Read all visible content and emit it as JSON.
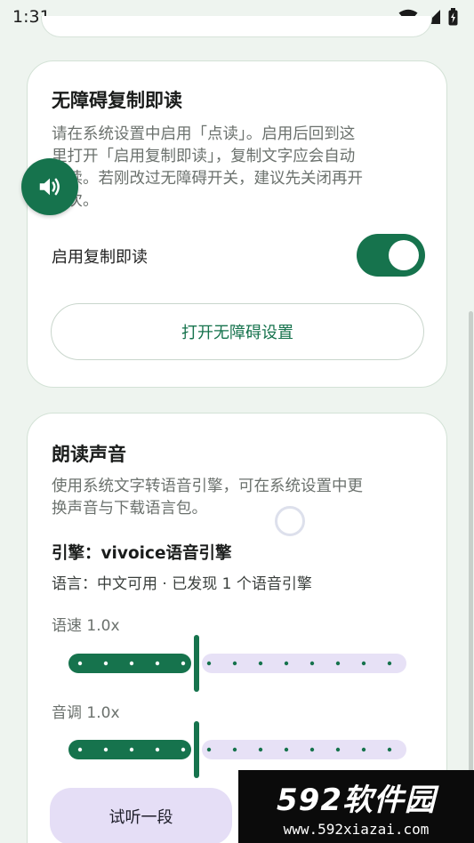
{
  "status_bar": {
    "time": "1:31"
  },
  "a11y_card": {
    "title": "无障碍复制即读",
    "desc_lines": [
      "请在系统设置中启用「点读」。启用后回到这",
      "里打开「启用复制即读」，复制文字应会自动",
      "朗读。若刚改过无障碍开关，建议先关闭再开",
      "一次。"
    ],
    "toggle_label": "启用复制即读",
    "toggle_on": true,
    "open_settings_button": "打开无障碍设置"
  },
  "voice_card": {
    "title": "朗读声音",
    "desc_lines": [
      "使用系统文字转语音引擎，可在系统设置中更",
      "换声音与下载语言包。"
    ],
    "engine": "引擎：vivoice语音引擎",
    "language": "语言：中文可用 · 已发现 1 个语音引擎",
    "speed": {
      "label": "语速 1.0x",
      "value": 1.0,
      "fraction": 0.38
    },
    "pitch": {
      "label": "音调 1.0x",
      "value": 1.0,
      "fraction": 0.38
    },
    "try_button": "试听一段"
  },
  "watermark": {
    "logo": "592软件园",
    "url": "www.592xiazai.com"
  },
  "icons": {
    "fab": "speaker-icon",
    "wifi": "wifi-icon",
    "signal": "signal-icon",
    "battery": "battery-icon"
  },
  "colors": {
    "primary": "#16734d",
    "track_inactive": "#e7e1f6",
    "background": "#eef4ef"
  }
}
